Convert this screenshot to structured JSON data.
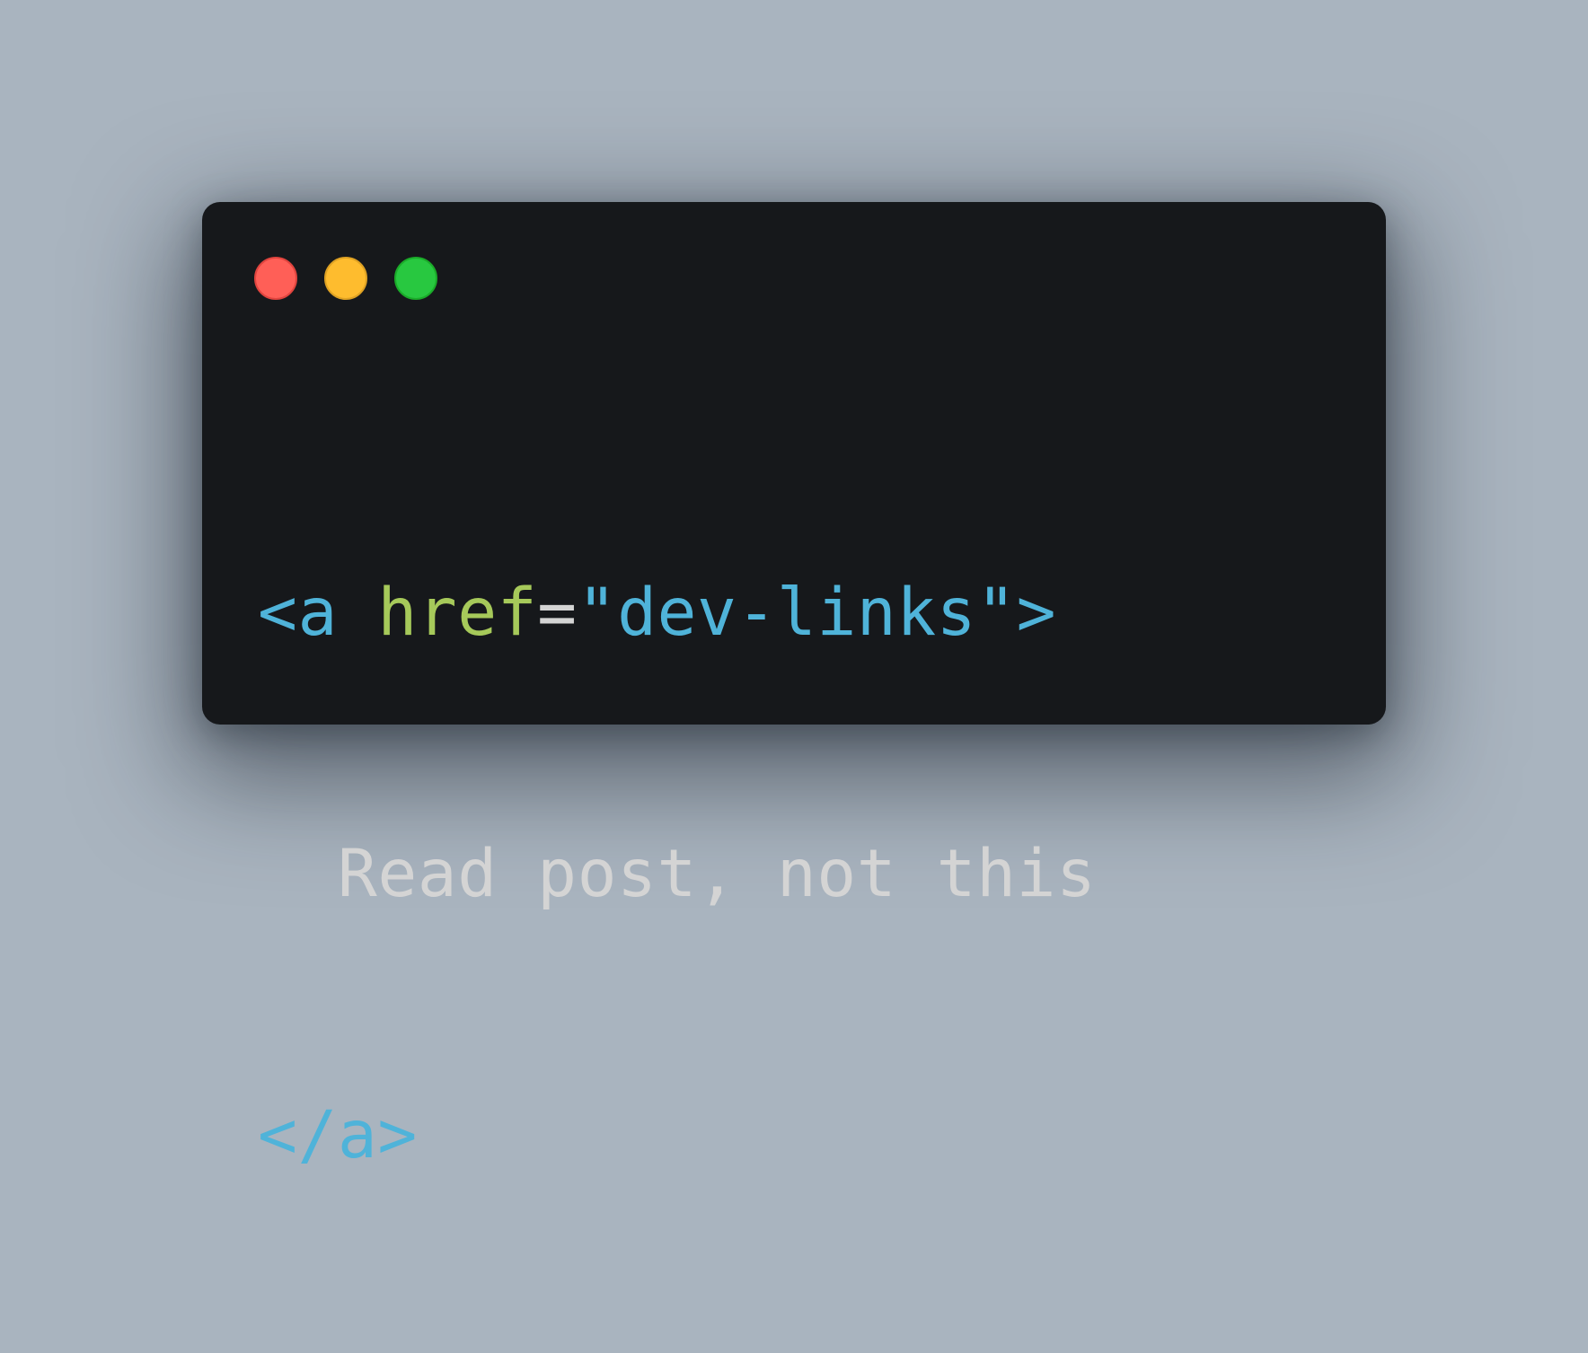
{
  "window": {
    "traffic_lights": [
      {
        "name": "close",
        "color": "#ff5f57"
      },
      {
        "name": "minimize",
        "color": "#febc2e"
      },
      {
        "name": "maximize",
        "color": "#28c840"
      }
    ]
  },
  "code": {
    "line1": {
      "open_tag": "<a",
      "attr_name": "href",
      "equals": "=",
      "attr_value": "\"dev-links\"",
      "close_bracket": ">"
    },
    "line2": {
      "indent": "  ",
      "text": "Read post, not this"
    },
    "line3": {
      "close_tag": "</a>"
    }
  },
  "colors": {
    "background": "#a9b4bf",
    "editor_bg": "#16181b",
    "tag": "#4fb3d9",
    "attribute": "#a6c95a",
    "text": "#d4d4d4"
  }
}
